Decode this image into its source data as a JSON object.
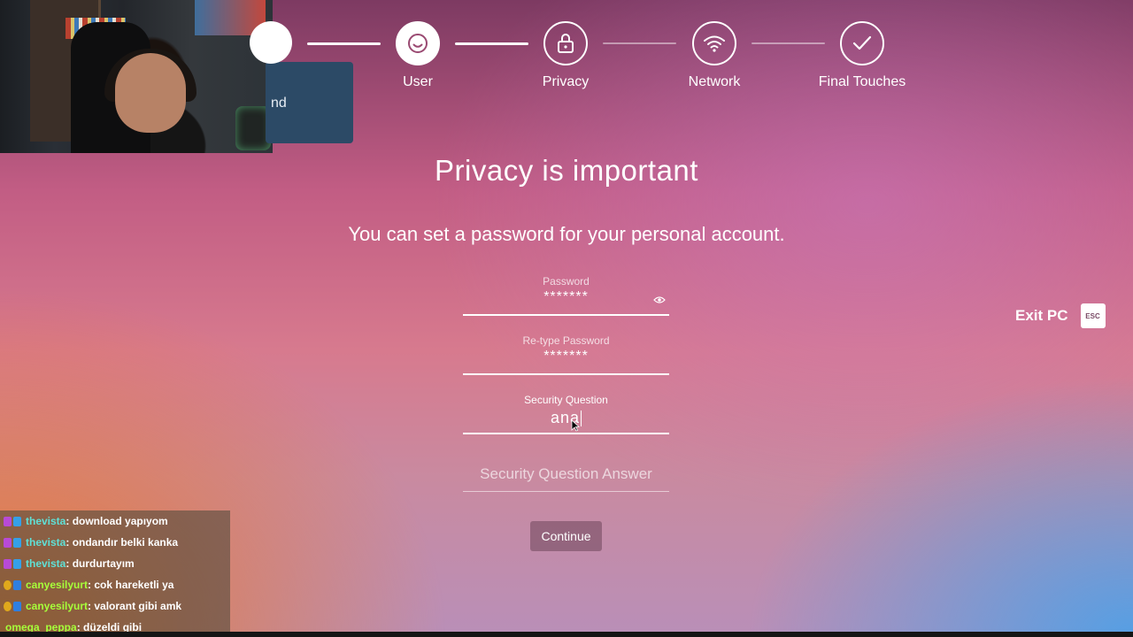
{
  "stepper": {
    "steps": [
      {
        "label": "User",
        "icon": "smile-icon",
        "active": true
      },
      {
        "label": "Privacy",
        "icon": "lock-icon",
        "active": false
      },
      {
        "label": "Network",
        "icon": "wifi-icon",
        "active": false
      },
      {
        "label": "Final Touches",
        "icon": "check-icon",
        "active": false
      }
    ],
    "previous_card_text": "nd"
  },
  "main": {
    "title": "Privacy is important",
    "subtitle": "You can set a password for your personal account.",
    "password": {
      "label": "Password",
      "value": "*******"
    },
    "retype_password": {
      "label": "Re-type Password",
      "value": "*******"
    },
    "security_question": {
      "label": "Security Question",
      "value": "ana"
    },
    "security_answer": {
      "placeholder": "Security Question Answer",
      "value": ""
    },
    "continue_label": "Continue"
  },
  "exit": {
    "label": "Exit PC",
    "key": "ESC"
  },
  "chat": [
    {
      "user": "thevista",
      "user_color": "#5fe0d6",
      "message": ": download yapıyom"
    },
    {
      "user": "thevista",
      "user_color": "#5fe0d6",
      "message": ": ondandır belki kanka"
    },
    {
      "user": "thevista",
      "user_color": "#5fe0d6",
      "message": ": durdurtayım"
    },
    {
      "user": "canyesilyurt",
      "user_color": "#a6ff3a",
      "message": ": cok hareketli ya"
    },
    {
      "user": "canyesilyurt",
      "user_color": "#a6ff3a",
      "message": ": valorant gibi amk"
    },
    {
      "user": "omega_peppa",
      "user_color": "#a6ff3a",
      "message": ": düzeldi gibi"
    }
  ],
  "colors": {
    "accent": "#ffffff",
    "button_bg": "#8a5a70",
    "esc_text": "#7a4a66"
  }
}
